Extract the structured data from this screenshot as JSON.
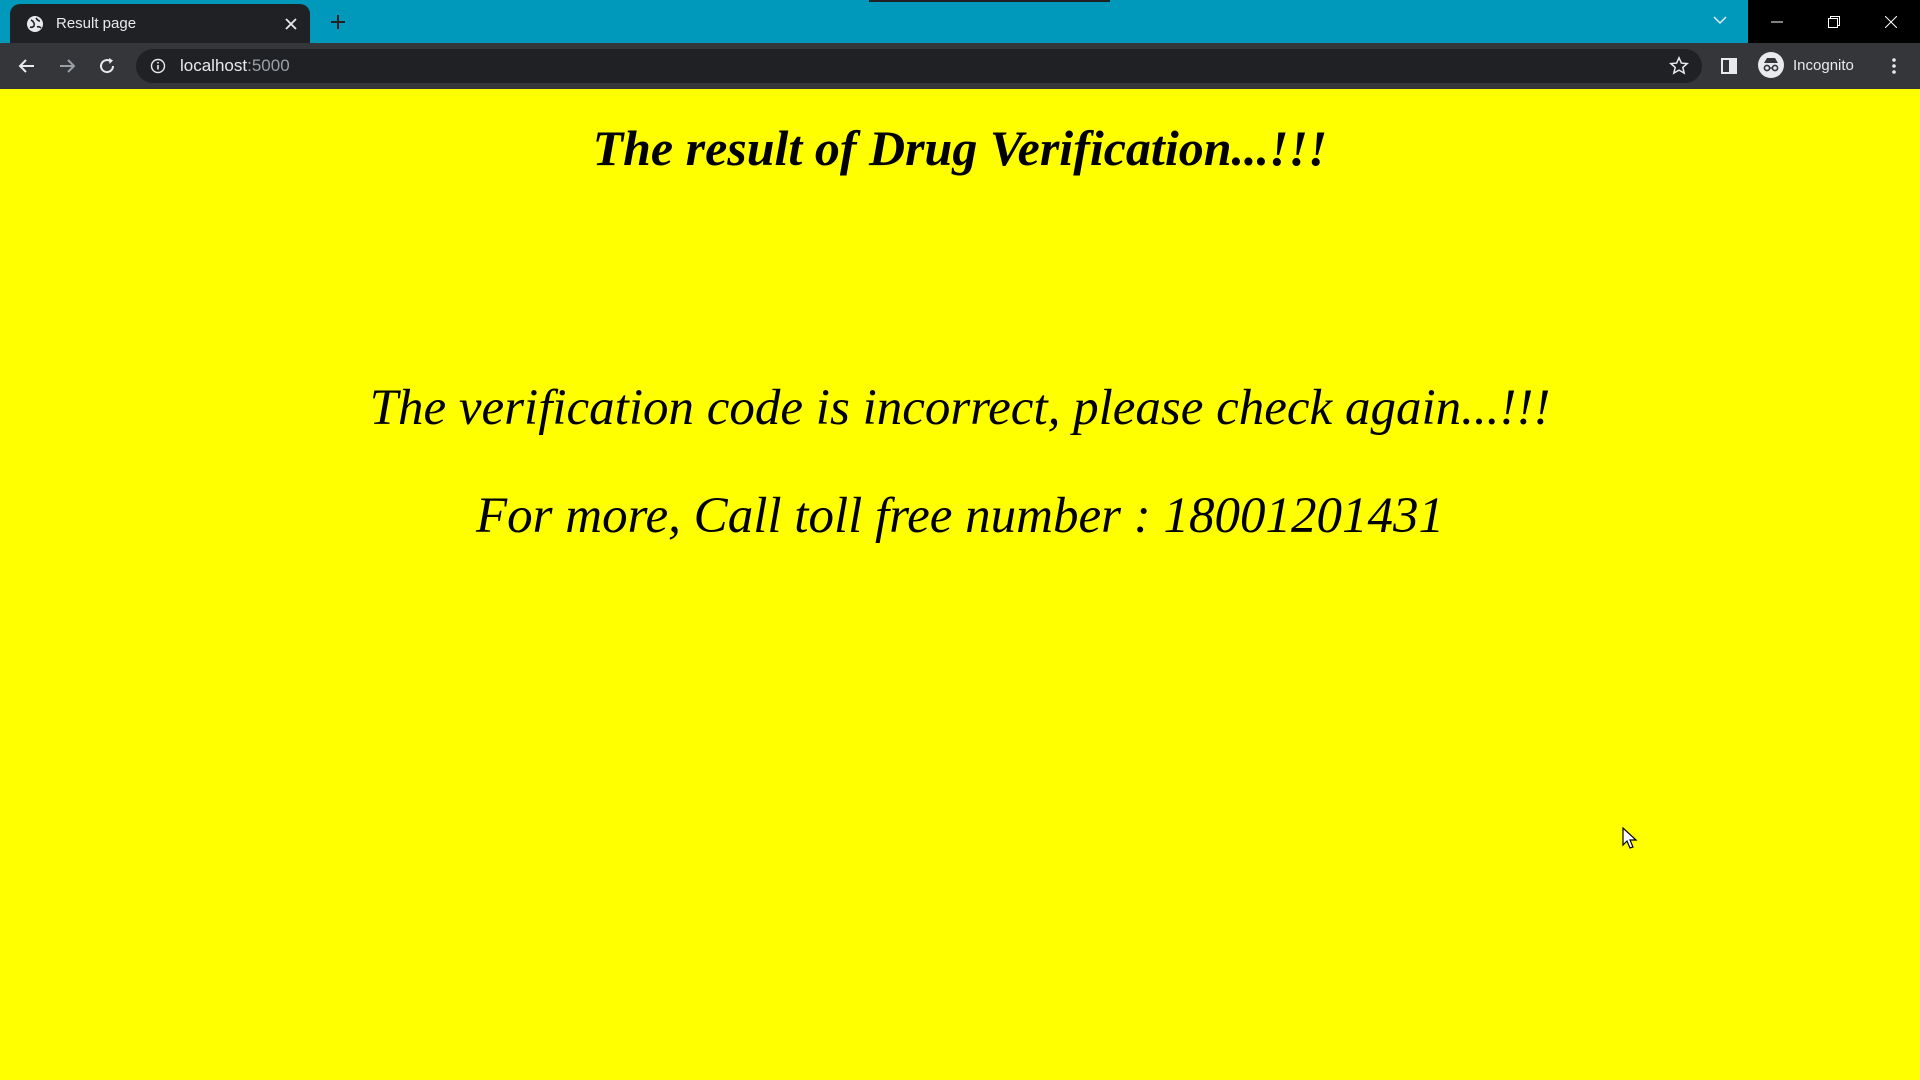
{
  "browser": {
    "tab": {
      "title": "Result page",
      "favicon": "globe-icon",
      "close_icon": "close-icon"
    },
    "new_tab_icon": "plus-icon",
    "tab_search_icon": "chevron-down-icon",
    "window_controls": {
      "minimize_icon": "minimize-icon",
      "restore_icon": "restore-icon",
      "close_icon": "close-icon"
    },
    "nav": {
      "back_icon": "arrow-left-icon",
      "forward_icon": "arrow-right-icon",
      "reload_icon": "reload-icon"
    },
    "address": {
      "host": "localhost",
      "port": ":5000",
      "info_icon": "info-icon",
      "bookmark_icon": "star-icon"
    },
    "side_panel_icon": "side-panel-icon",
    "profile": {
      "label": "Incognito",
      "icon": "incognito-icon"
    },
    "menu_icon": "kebab-menu-icon",
    "colors": {
      "tabstrip": "#0099bb",
      "toolbar": "#35363a",
      "omnibox": "#202124"
    }
  },
  "page": {
    "heading": "The result of Drug Verification...!!!",
    "message": "The verification code is incorrect, please check again...!!!",
    "contact": "For more, Call toll free number : 18001201431",
    "background_color": "#ffff00"
  }
}
